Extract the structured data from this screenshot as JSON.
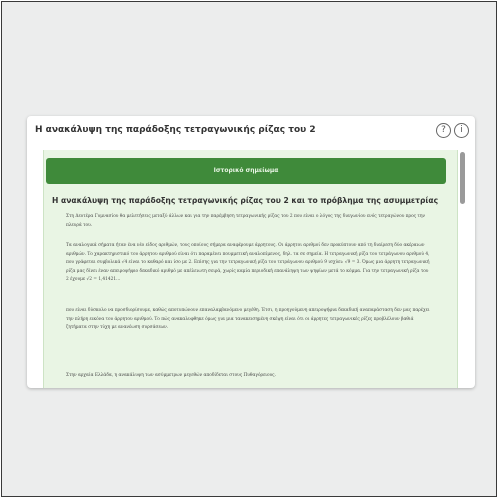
{
  "card": {
    "title": "Η ανακάλυψη της παράδοξης τετραγωνικής ρίζας του 2"
  },
  "icons": {
    "help": "?",
    "info": "i"
  },
  "content": {
    "banner_label": "Ιστορικό σημείωμα",
    "section_title": "Η ανακάλυψη της παράδοξης τετραγωνικής ρίζας του 2 και το πρόβλημα της ασυμμετρίας",
    "paragraphs": [
      "Στη Δευτέρα Γυμνασίου θα μελετήσεις μεταξύ άλλων και για την παρέμβηση τετραγωνικής ρίζας του 2 που είναι ο λόγος της διαγωνίου ενός τετραγώνου προς την πλευρά του.",
      "Τα αναλογικά σήματα ήταν ένα νέο είδος αριθμών, τους οποίους σήμερα αναφέρουμε άρρητους. Οι άρρητοι αριθμοί δεν προκύπτουν από τη διαίρεση δύο ακέραιων αριθμών. Το χαρακτηριστικό του άρρητου αριθμού είναι ότι παραμένει πουμμετική αναλοπίμενος, δηλ. τα σε σημεία. Η τετραγωνική ρίζα του τετράγωνου αριθμού 4, που γράφεται συμβολικά √4 είναι το καθαρό και ίσο με 2. Επίσης για την τετραγωνική ρίζα του τετράγωνου αριθμού 9 ισχύει: √9 = 3. Όμως μια άρρητη τετραγωνική ρίζα μας δίνει έναν απειροψήφιο δεκαδικό αριθμό με απέλειωτη σειρά, χωρίς καμία περιοδική επανάληψη των ψηφίων μετά το κόμμα. Για την τετραγωνική ρίζα του 2 έχουμε √2 = 1,41421...",
      "που είναι δύσκολο να προσδιορίσουμε, καθώς αποτυπώνουν επαναλαμβανόμενο μεγέθη. Έτσι, η προηγούμενη απειροψήφια δεκαδική αναπαράσταση δεν μας παρέχει την πλήρη εικόνα του άρρητου αριθμού. Το πώς ανακαλυφθηκε όμως για μια τανακεισημένη σκέψη είναι ότι οι άρρητες τετραγωνικές ρίζες προβλέλουν βαθιά ζητήματα στην τύχη με ανανέωση συρσάσεων.",
      "Στην αρχαία Ελλάδα, η ανακάλυψη των ασύμμετρων μεγεθών αποδίδεται στους Πυθαγόρειους."
    ]
  }
}
